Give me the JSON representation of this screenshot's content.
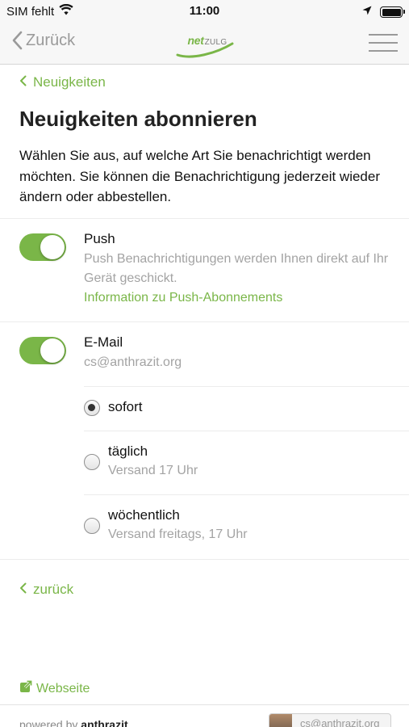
{
  "status_bar": {
    "carrier": "SIM fehlt",
    "time": "11:00",
    "icons": [
      "wifi-icon",
      "location-arrow-icon",
      "battery-icon"
    ]
  },
  "nav": {
    "back_label": "Zurück",
    "logo_main": "net",
    "logo_sub": "ZULG",
    "menu_icon": "hamburger-menu-icon"
  },
  "page": {
    "breadcrumb": "Neuigkeiten",
    "title": "Neuigkeiten abonnieren",
    "intro": "Wählen Sie aus, auf welche Art Sie benachrichtigt werden möchten. Sie können die Benachrichtigung jederzeit wieder ändern oder abbestellen."
  },
  "push": {
    "enabled": true,
    "title": "Push",
    "description": "Push Benachrichtigungen werden Ihnen direkt auf Ihr Gerät geschickt.",
    "info_link": "Information zu Push-Abonnements"
  },
  "email": {
    "enabled": true,
    "title": "E-Mail",
    "address": "cs@anthrazit.org",
    "options": [
      {
        "label": "sofort",
        "sub": "",
        "selected": true
      },
      {
        "label": "täglich",
        "sub": "Versand 17 Uhr",
        "selected": false
      },
      {
        "label": "wöchentlich",
        "sub": "Versand freitags, 17 Uhr",
        "selected": false
      }
    ]
  },
  "footer": {
    "back_link": "zurück",
    "website_link": "Webseite",
    "powered_prefix": "powered by",
    "powered_brand": "anthrazit",
    "user_email": "cs@anthrazit.org"
  },
  "colors": {
    "accent": "#7ab648",
    "muted": "#a3a3a3",
    "bar": "#f7f7f7"
  }
}
